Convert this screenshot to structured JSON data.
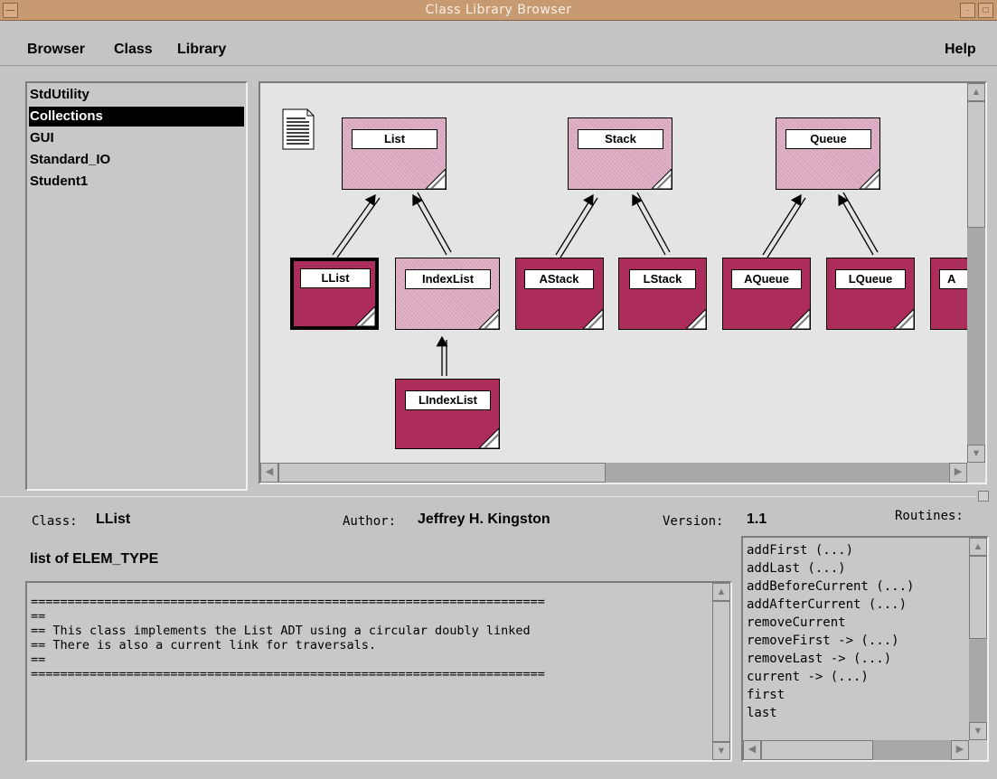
{
  "window": {
    "title": "Class Library Browser"
  },
  "menu": {
    "browser": "Browser",
    "class": "Class",
    "library": "Library",
    "help": "Help"
  },
  "libraries": [
    "StdUtility",
    "Collections",
    "GUI",
    "Standard_IO",
    "Student1"
  ],
  "selected_library": "Collections",
  "diagram": {
    "nodes": {
      "list": "List",
      "stack": "Stack",
      "queue": "Queue",
      "llist": "LList",
      "indexlist": "IndexList",
      "astack": "AStack",
      "lstack": "LStack",
      "aqueue": "AQueue",
      "lqueue": "LQueue",
      "partial": "A",
      "lindexlist": "LIndexList"
    },
    "selected_node": "LList",
    "colors": {
      "abstract": "#d8a4bc",
      "concrete": "#ac2c5c",
      "canvas": "#e4e4e4"
    }
  },
  "details": {
    "class_label": "Class:",
    "class_value": "LList",
    "author_label": "Author:",
    "author_value": "Jeffrey H. Kingston",
    "version_label": "Version:",
    "version_value": "1.1",
    "routines_label": "Routines:",
    "summary": "list of ELEM_TYPE"
  },
  "description": [
    "======================================================================",
    "==",
    "== This class implements the List ADT using a circular doubly linked",
    "== There is also a current link for traversals.",
    "==",
    "======================================================================"
  ],
  "routines": [
    "addFirst (...)",
    "addLast (...)",
    "addBeforeCurrent (...)",
    "addAfterCurrent (...)",
    "removeCurrent",
    "removeFirst -> (...)",
    "removeLast -> (...)",
    "current -> (...)",
    "first",
    "last"
  ]
}
